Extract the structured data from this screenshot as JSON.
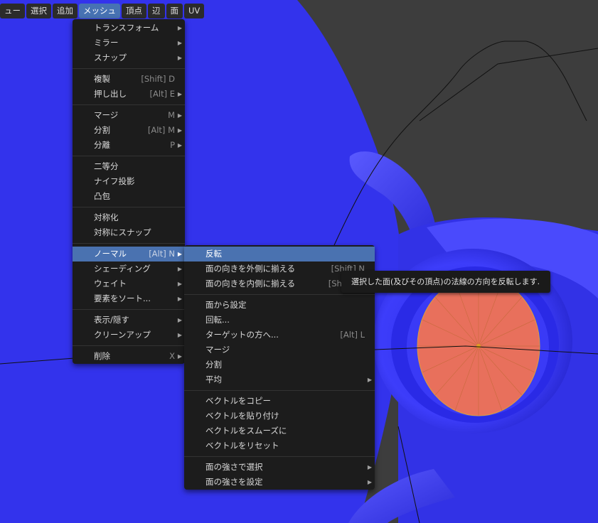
{
  "topbar": {
    "items": [
      {
        "label": "ュー"
      },
      {
        "label": "選択"
      },
      {
        "label": "追加"
      },
      {
        "label": "メッシュ"
      },
      {
        "label": "頂点"
      },
      {
        "label": "辺"
      },
      {
        "label": "面"
      },
      {
        "label": "UV"
      }
    ]
  },
  "mesh_menu": {
    "items": [
      {
        "label": "トランスフォーム",
        "shortcut": ""
      },
      {
        "label": "ミラー",
        "shortcut": ""
      },
      {
        "label": "スナップ",
        "shortcut": ""
      },
      {
        "label": "複製",
        "shortcut": "[Shift] D"
      },
      {
        "label": "押し出し",
        "shortcut": "[Alt] E"
      },
      {
        "label": "マージ",
        "shortcut": "M"
      },
      {
        "label": "分割",
        "shortcut": "[Alt] M"
      },
      {
        "label": "分離",
        "shortcut": "P"
      },
      {
        "label": "二等分",
        "shortcut": ""
      },
      {
        "label": "ナイフ投影",
        "shortcut": ""
      },
      {
        "label": "凸包",
        "shortcut": ""
      },
      {
        "label": "対称化",
        "shortcut": ""
      },
      {
        "label": "対称にスナップ",
        "shortcut": ""
      },
      {
        "label": "ノーマル",
        "shortcut": "[Alt] N"
      },
      {
        "label": "シェーディング",
        "shortcut": ""
      },
      {
        "label": "ウェイト",
        "shortcut": ""
      },
      {
        "label": "要素をソート...",
        "shortcut": ""
      },
      {
        "label": "表示/隠す",
        "shortcut": ""
      },
      {
        "label": "クリーンアップ",
        "shortcut": ""
      },
      {
        "label": "削除",
        "shortcut": "X"
      }
    ]
  },
  "normal_menu": {
    "items": [
      {
        "label": "反転",
        "shortcut": ""
      },
      {
        "label": "面の向きを外側に揃える",
        "shortcut": "[Shift] N"
      },
      {
        "label": "面の向きを内側に揃える",
        "shortcut": "[Shift] [C"
      },
      {
        "label": "面から設定",
        "shortcut": ""
      },
      {
        "label": "回転...",
        "shortcut": ""
      },
      {
        "label": "ターゲットの方へ...",
        "shortcut": "[Alt] L"
      },
      {
        "label": "マージ",
        "shortcut": ""
      },
      {
        "label": "分割",
        "shortcut": ""
      },
      {
        "label": "平均",
        "shortcut": ""
      },
      {
        "label": "ベクトルをコピー",
        "shortcut": ""
      },
      {
        "label": "ベクトルを貼り付け",
        "shortcut": ""
      },
      {
        "label": "ベクトルをスムーズに",
        "shortcut": ""
      },
      {
        "label": "ベクトルをリセット",
        "shortcut": ""
      },
      {
        "label": "面の強さで選択",
        "shortcut": ""
      },
      {
        "label": "面の強さを設定",
        "shortcut": ""
      }
    ]
  },
  "tooltip": {
    "text": "選択した面(及びその頂点)の法線の方向を反転します."
  },
  "colors": {
    "accent": "#4a72b0",
    "mesh_blue": "#3535f0",
    "selected_face": "#e8705c",
    "background": "#3d3d3d"
  }
}
